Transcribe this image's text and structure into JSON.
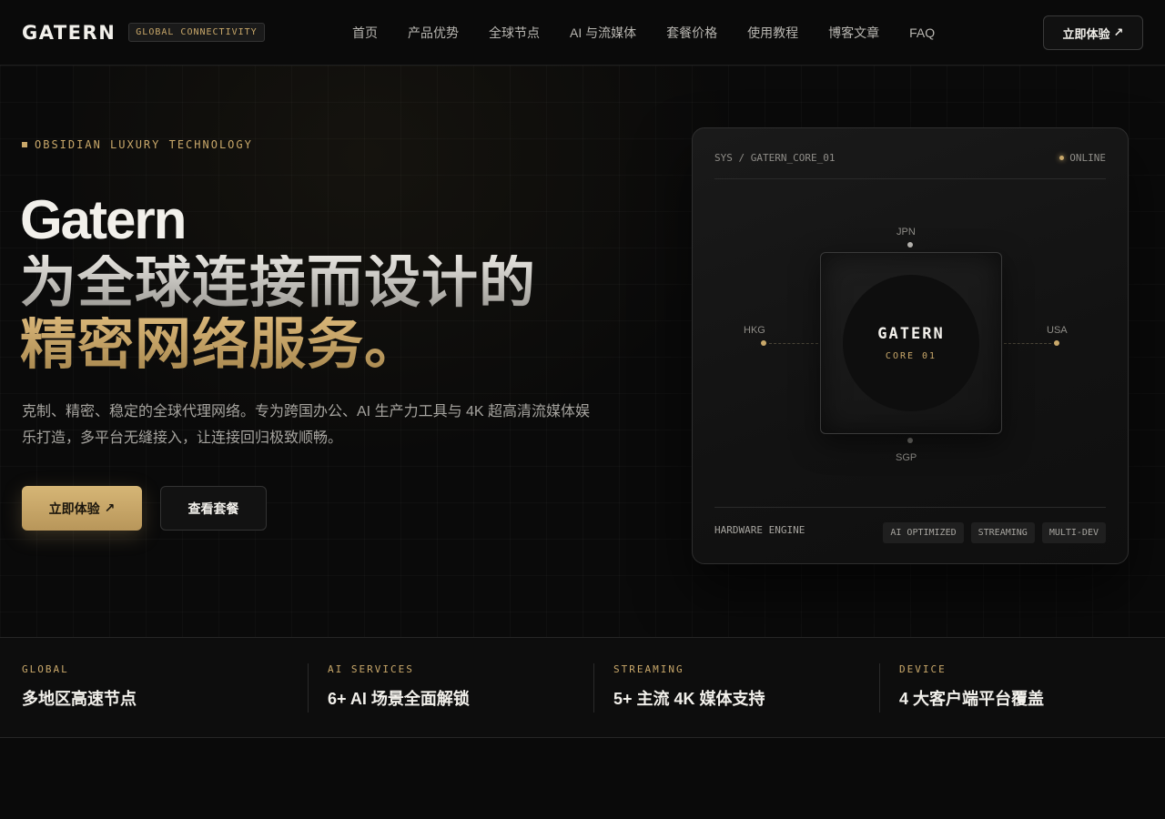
{
  "header": {
    "logo": "GATERN",
    "badge": "GLOBAL CONNECTIVITY",
    "nav": [
      "首页",
      "产品优势",
      "全球节点",
      "AI 与流媒体",
      "套餐价格",
      "使用教程",
      "博客文章",
      "FAQ"
    ],
    "cta": "立即体验",
    "cta_icon": "↗"
  },
  "hero": {
    "eyebrow": "OBSIDIAN LUXURY TECHNOLOGY",
    "title_line1": "Gatern",
    "title_line2": "为全球连接而设计的",
    "title_line3": "精密网络服务。",
    "description": "克制、精密、稳定的全球代理网络。专为跨国办公、AI 生产力工具与 4K 超高清流媒体娱乐打造，多平台无缝接入，让连接回归极致顺畅。",
    "primary_button": "立即体验",
    "primary_icon": "↗",
    "secondary_button": "查看套餐"
  },
  "card": {
    "system_label": "SYS / GATERN_CORE_01",
    "status": "ONLINE",
    "chip_title": "GATERN",
    "chip_subtitle": "CORE 01",
    "nodes": {
      "top": "JPN",
      "left": "HKG",
      "right": "USA",
      "bottom": "SGP"
    },
    "engine_label": "HARDWARE ENGINE",
    "tags": [
      "AI OPTIMIZED",
      "STREAMING",
      "MULTI-DEV"
    ]
  },
  "stats": [
    {
      "eyebrow": "GLOBAL",
      "value": "多地区高速节点"
    },
    {
      "eyebrow": "AI SERVICES",
      "value": "6+ AI 场景全面解锁"
    },
    {
      "eyebrow": "STREAMING",
      "value": "5+ 主流 4K 媒体支持"
    },
    {
      "eyebrow": "DEVICE",
      "value": "4 大客户端平台覆盖"
    }
  ],
  "colors": {
    "accent": "#c9a86a",
    "background": "#0a0a0a",
    "text": "#f2f0eb"
  }
}
